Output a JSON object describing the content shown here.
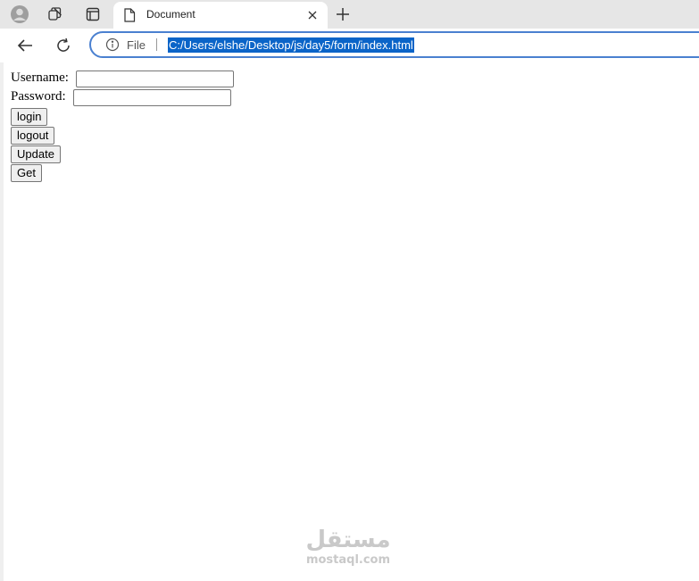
{
  "browser": {
    "tab": {
      "title": "Document",
      "favicon": "document-icon"
    },
    "address_bar": {
      "scheme_label": "File",
      "url": "C:/Users/elshe/Desktop/js/day5/form/index.html"
    },
    "icons": {
      "profile": "profile-avatar-icon",
      "workspaces": "workspaces-icon",
      "tab_actions": "tab-actions-icon",
      "close": "close-icon",
      "new_tab": "plus-icon",
      "back": "back-arrow-icon",
      "refresh": "refresh-icon",
      "info": "info-icon"
    },
    "colors": {
      "url_selection": "#0a64c8",
      "omnibox_border": "#4a80d0"
    }
  },
  "page": {
    "username_label": "Username:",
    "username_value": "",
    "password_label": "Password:",
    "password_value": "",
    "buttons": {
      "login": "login",
      "logout": "logout",
      "update": "Update",
      "get": "Get"
    }
  },
  "watermark": {
    "arabic": "مستقل",
    "latin": "mostaql.com"
  }
}
